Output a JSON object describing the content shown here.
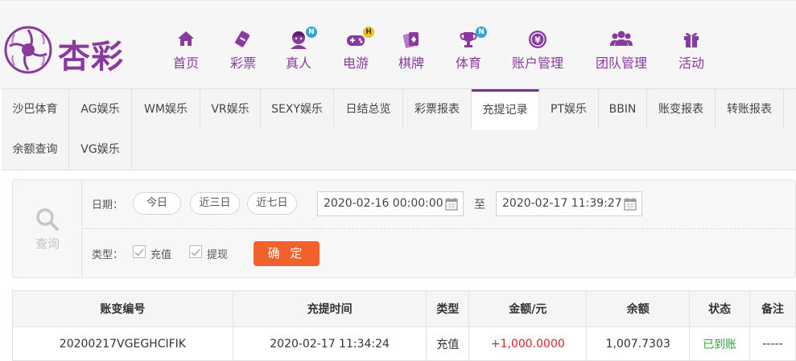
{
  "brand": {
    "name": "杏彩",
    "color": "#8a3a9e"
  },
  "nav": [
    {
      "label": "首页",
      "icon": "home-icon"
    },
    {
      "label": "彩票",
      "icon": "ticket-icon"
    },
    {
      "label": "真人",
      "icon": "dealer-icon",
      "badge": "N"
    },
    {
      "label": "电游",
      "icon": "gamepad-icon",
      "badge": "H"
    },
    {
      "label": "棋牌",
      "icon": "cards-icon"
    },
    {
      "label": "体育",
      "icon": "trophy-icon",
      "badge": "N"
    },
    {
      "label": "账户管理",
      "icon": "yen-icon"
    },
    {
      "label": "团队管理",
      "icon": "team-icon"
    },
    {
      "label": "活动",
      "icon": "gift-icon"
    }
  ],
  "tabs": [
    "沙巴体育",
    "AG娱乐",
    "WM娱乐",
    "VR娱乐",
    "SEXY娱乐",
    "日结总览",
    "彩票报表",
    "充提记录",
    "PT娱乐",
    "BBIN",
    "账变报表",
    "转账报表",
    "余额查询",
    "VG娱乐"
  ],
  "active_tab": "充提记录",
  "query": {
    "title": "查询",
    "date_label": "日期：",
    "quick": [
      "今日",
      "近三日",
      "近七日"
    ],
    "from": "2020-02-16 00:00:00",
    "separator": "至",
    "to": "2020-02-17 11:39:27",
    "type_label": "类型：",
    "types": [
      "充值",
      "提现"
    ],
    "confirm": "确 定"
  },
  "table": {
    "headers": [
      "账变编号",
      "充提时间",
      "类型",
      "金额/元",
      "余额",
      "状态",
      "备注"
    ],
    "rows": [
      {
        "id": "20200217VGEGHCIFIK",
        "time": "2020-02-17 11:34:24",
        "type": "充值",
        "amount": "+1,000.0000",
        "balance": "1,007.7303",
        "status": "已到账",
        "remark": "-----"
      }
    ]
  },
  "colors": {
    "amount": "#d8252b",
    "status": "#2fa534",
    "confirm": "#f0612b"
  }
}
